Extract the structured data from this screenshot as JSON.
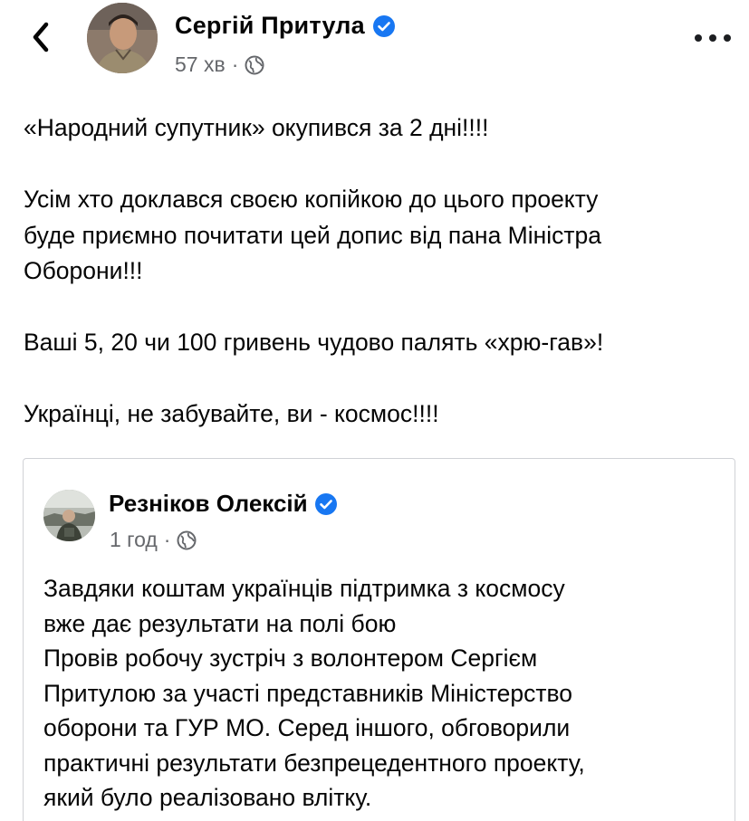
{
  "header": {
    "author_name": "Сергій Притула",
    "time": "57 хв",
    "separator": "·",
    "verified_icon": "verified-badge-icon",
    "audience_icon": "globe-icon",
    "back_icon": "chevron-left-icon",
    "more_icon": "more-horizontal-icon"
  },
  "post": {
    "paragraphs": [
      "«Народний супутник» окупився за 2 дні!!!!",
      "Усім хто доклався своєю копійкою до цього проекту\nбуде приємно почитати цей допис від пана Міністра\nОборони!!!",
      "Ваші 5, 20 чи 100 гривень чудово палять «хрю-гав»!",
      "Українці, не забувайте, ви - космос!!!!"
    ]
  },
  "shared_post": {
    "author_name": "Резніков Олексій",
    "time": "1 год",
    "separator": "·",
    "lines": [
      "Завдяки коштам українців підтримка з космосу",
      "вже дає результати на полі бою",
      "Провів робочу зустріч з волонтером Сергієм",
      "Притулою за участі представників Міністерство",
      "оборони та ГУР МО. Серед іншого, обговорили",
      "практичні результати безпрецедентного проекту,",
      "який було реалізовано влітку."
    ]
  },
  "colors": {
    "text": "#050505",
    "secondary": "#65676b",
    "verified": "#1877f2",
    "border": "#d0d2d6"
  }
}
